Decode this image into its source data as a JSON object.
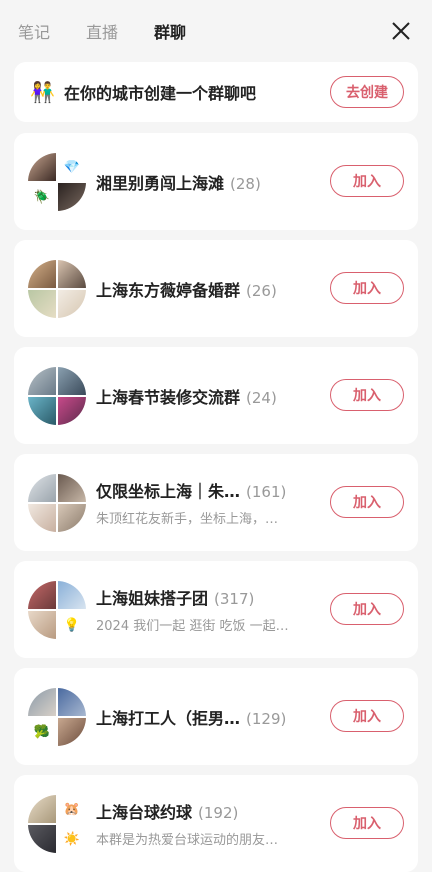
{
  "tabs": [
    {
      "label": "笔记",
      "active": false
    },
    {
      "label": "直播",
      "active": false
    },
    {
      "label": "群聊",
      "active": true
    }
  ],
  "promo": {
    "emoji": "👫",
    "text": "在你的城市创建一个群聊吧",
    "button": "去创建"
  },
  "groups": [
    {
      "name": "湘里别勇闯上海滩",
      "count": "(28)",
      "desc": "",
      "button": "加入",
      "badges": [
        "",
        "💎",
        "🪲",
        ""
      ]
    },
    {
      "name": "上海东方薇婷备婚群",
      "count": "(26)",
      "desc": "",
      "button": "加入",
      "badges": [
        "",
        "",
        "",
        ""
      ]
    },
    {
      "name": "上海春节装修交流群",
      "count": "(24)",
      "desc": "",
      "button": "加入",
      "badges": [
        "",
        "",
        "",
        ""
      ]
    },
    {
      "name": "仅限坐标上海｜朱…",
      "count": "(161)",
      "desc": "朱顶红花友新手，坐标上海，…",
      "button": "加入",
      "badges": [
        "",
        "",
        "",
        ""
      ]
    },
    {
      "name": "上海姐妹搭子团",
      "count": "(317)",
      "desc": "2024 我们一起 逛街 吃饭 一起…",
      "button": "加入",
      "badges": [
        "",
        "",
        "",
        "💡"
      ]
    },
    {
      "name": "上海打工人（拒男…",
      "count": "(129)",
      "desc": "",
      "button": "加入",
      "badges": [
        "",
        "",
        "🥦",
        ""
      ]
    },
    {
      "name": "上海台球约球",
      "count": "(192)",
      "desc": "本群是为热爱台球运动的朋友…",
      "button": "加入",
      "badges": [
        "",
        "🐹",
        "",
        "☀️"
      ]
    }
  ],
  "colors": {
    "accent": "#d9606e"
  }
}
